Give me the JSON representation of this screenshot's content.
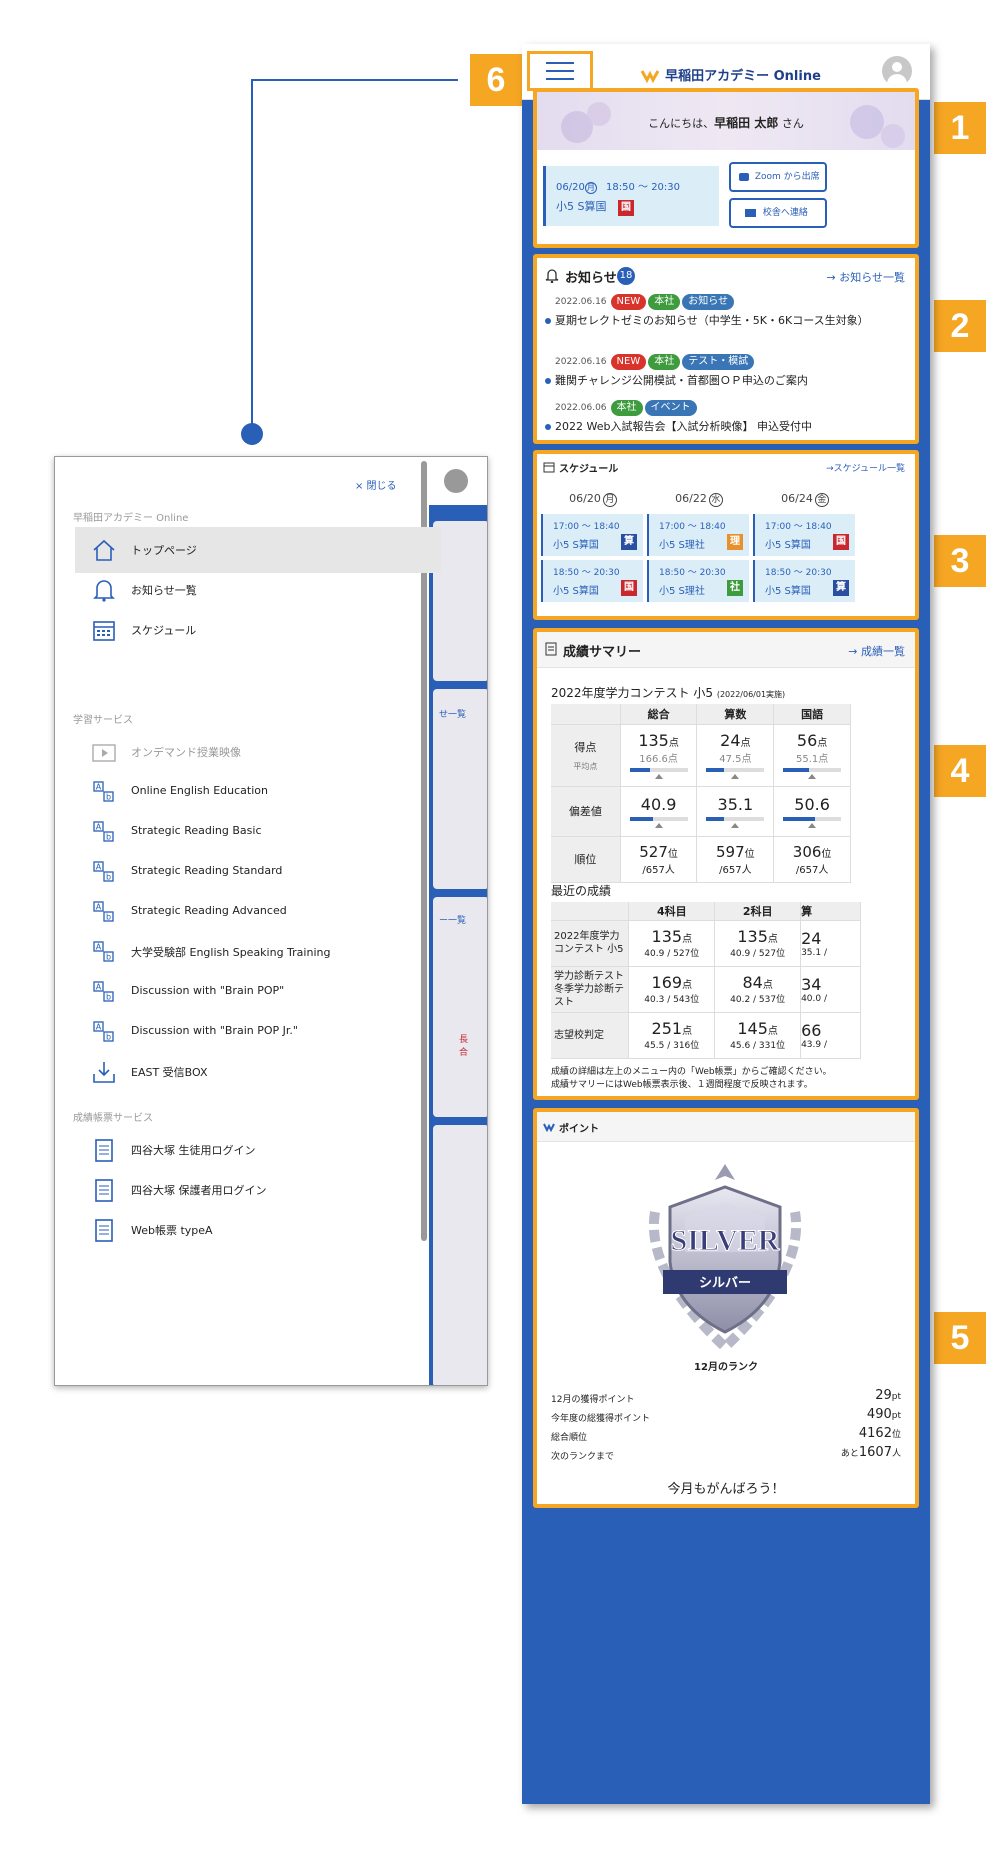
{
  "colors": {
    "accent": "#2a5fb8",
    "callout": "#f5a623",
    "new": "#d9342b",
    "honsha": "#3e9b3e",
    "category": "#3a76b5"
  },
  "callouts": [
    "1",
    "2",
    "3",
    "4",
    "5",
    "6"
  ],
  "app": {
    "title": "早稲田アカデミー Online"
  },
  "greeting": {
    "prefix": "こんにちは、",
    "name": "早稲田 太郎",
    "suffix": "さん"
  },
  "next_class": {
    "date": "06/20",
    "weekday": "月",
    "time": "18:50 ～ 20:30",
    "class_name": "小5 S算国",
    "subject": "国"
  },
  "buttons": {
    "zoom": "Zoom から出席",
    "contact": "校舎へ連絡"
  },
  "news": {
    "title": "お知らせ",
    "count": "18",
    "link": "お知らせ一覧",
    "items": [
      {
        "date": "2022.06.16",
        "tags": [
          "NEW",
          "本社",
          "お知らせ"
        ],
        "text": "夏期セレクトゼミのお知らせ（中学生・5K・6Kコース生対象）"
      },
      {
        "date": "2022.06.16",
        "tags": [
          "NEW",
          "本社",
          "テスト・模試"
        ],
        "text": "難関チャレンジ公開模試・首都圏ＯＰ申込のご案内"
      },
      {
        "date": "2022.06.06",
        "tags": [
          "本社",
          "イベント"
        ],
        "text": "2022 Web入試報告会【入試分析映像】 申込受付中"
      }
    ]
  },
  "schedule": {
    "title": "スケジュール",
    "link": "スケジュール一覧",
    "days": [
      {
        "date": "06/20",
        "weekday": "月",
        "slots": [
          {
            "time": "17:00 ～ 18:40",
            "name": "小5 S算国",
            "subject": "算",
            "color": "#2a4fa0"
          },
          {
            "time": "18:50 ～ 20:30",
            "name": "小5 S算国",
            "subject": "国",
            "color": "#c8282e"
          }
        ]
      },
      {
        "date": "06/22",
        "weekday": "水",
        "slots": [
          {
            "time": "17:00 ～ 18:40",
            "name": "小5 S理社",
            "subject": "理",
            "color": "#e8902c"
          },
          {
            "time": "18:50 ～ 20:30",
            "name": "小5 S理社",
            "subject": "社",
            "color": "#3e9b3e"
          }
        ]
      },
      {
        "date": "06/24",
        "weekday": "金",
        "slots": [
          {
            "time": "17:00 ～ 18:40",
            "name": "小5 S算国",
            "subject": "国",
            "color": "#c8282e"
          },
          {
            "time": "18:50 ～ 20:30",
            "name": "小5 S算国",
            "subject": "算",
            "color": "#2a4fa0"
          }
        ]
      }
    ]
  },
  "grades": {
    "title": "成績サマリー",
    "link": "成績一覧",
    "contest": "2022年度学力コンテスト 小5",
    "contest_date": "(2022/06/01実施)",
    "cols": [
      "総合",
      "算数",
      "国語"
    ],
    "rows": {
      "score": "得点",
      "avg": "平均点",
      "dev": "偏差値",
      "rank": "順位"
    },
    "score": [
      {
        "v": "135",
        "u": "点",
        "avg": "166.6点",
        "fill": 0.35
      },
      {
        "v": "24",
        "u": "点",
        "avg": "47.5点",
        "fill": 0.3
      },
      {
        "v": "56",
        "u": "点",
        "avg": "55.1点",
        "fill": 0.45
      }
    ],
    "dev": [
      {
        "v": "40.9",
        "fill": 0.4
      },
      {
        "v": "35.1",
        "fill": 0.3
      },
      {
        "v": "50.6",
        "fill": 0.55
      }
    ],
    "rank": [
      {
        "v": "527",
        "u": "位",
        "of": "/657人"
      },
      {
        "v": "597",
        "u": "位",
        "of": "/657人"
      },
      {
        "v": "306",
        "u": "位",
        "of": "/657人"
      }
    ],
    "recent_title": "最近の成績",
    "recent_cols": [
      "4科目",
      "2科目",
      "算"
    ],
    "recent_rows": [
      {
        "name": "2022年度学力コンテスト 小5",
        "c1": "135",
        "c1s": "40.9 / 527位",
        "c2": "135",
        "c2s": "40.9 / 527位",
        "c3": "24",
        "c3s": "35.1 /"
      },
      {
        "name": "学力診断テスト 冬季学力診断テスト",
        "c1": "169",
        "c1s": "40.3 / 543位",
        "c2": "84",
        "c2s": "40.2 / 537位",
        "c3": "34",
        "c3s": "40.0 /"
      },
      {
        "name": "志望校判定",
        "c1": "251",
        "c1s": "45.5 / 316位",
        "c2": "145",
        "c2s": "45.6 / 331位",
        "c3": "66",
        "c3s": "43.9 /"
      }
    ],
    "unit": "点",
    "note1": "成績の詳細は左上のメニュー内の「Web帳票」からご確認ください。",
    "note2": "成績サマリーにはWeb帳票表示後、１週間程度で反映されます。"
  },
  "points": {
    "title": "ポイント",
    "badge_en": "SILVER",
    "badge_jp": "シルバー",
    "rank_caption": "12月のランク",
    "rows": [
      {
        "label": "12月の獲得ポイント",
        "value": "29",
        "unit": "pt",
        "prefix": ""
      },
      {
        "label": "今年度の総獲得ポイント",
        "value": "490",
        "unit": "pt",
        "prefix": ""
      },
      {
        "label": "総合順位",
        "value": "4162",
        "unit": "位",
        "prefix": ""
      },
      {
        "label": "次のランクまで",
        "value": "1607",
        "unit": "人",
        "prefix": "あと"
      }
    ],
    "footer": "今月もがんばろう！"
  },
  "drawer": {
    "close": "× 閉じる",
    "section1": "早稲田アカデミー Online",
    "items1": [
      {
        "label": "トップページ",
        "icon": "home-icon"
      },
      {
        "label": "お知らせ一覧",
        "icon": "bell-icon"
      },
      {
        "label": "スケジュール",
        "icon": "calendar-icon"
      }
    ],
    "section2": "学習サービス",
    "items2": [
      {
        "label": "オンデマンド授業映像",
        "icon": "play-icon"
      },
      {
        "label": "Online English Education",
        "icon": "abc-icon"
      },
      {
        "label": "Strategic Reading Basic",
        "icon": "abc-icon"
      },
      {
        "label": "Strategic Reading Standard",
        "icon": "abc-icon"
      },
      {
        "label": "Strategic Reading Advanced",
        "icon": "abc-icon"
      },
      {
        "label": "大学受験部 English Speaking Training",
        "icon": "abc-icon"
      },
      {
        "label": "Discussion with \"Brain POP\"",
        "icon": "abc-icon"
      },
      {
        "label": "Discussion with \"Brain POP Jr.\"",
        "icon": "abc-icon"
      },
      {
        "label": "EAST 受信BOX",
        "icon": "inbox-icon"
      }
    ],
    "section3": "成績帳票サービス",
    "items3": [
      {
        "label": "四谷大塚 生徒用ログイン",
        "icon": "doc-icon"
      },
      {
        "label": "四谷大塚 保護者用ログイン",
        "icon": "doc-icon"
      },
      {
        "label": "Web帳票 typeA",
        "icon": "doc-icon"
      }
    ],
    "bg_fragments": [
      "せ一覧",
      "ー一覧",
      "長",
      "合"
    ]
  }
}
